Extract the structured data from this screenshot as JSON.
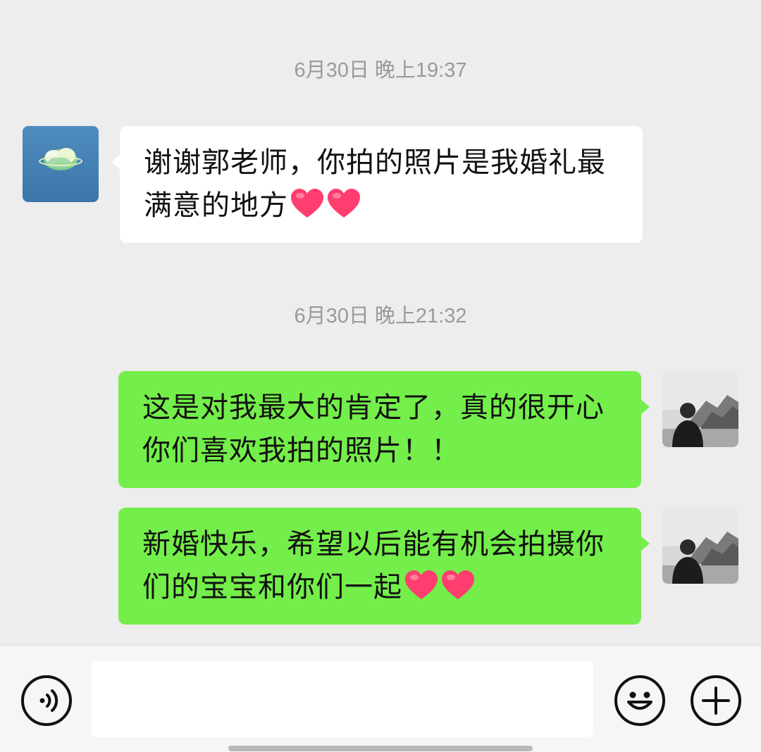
{
  "messages": [
    {
      "timestamp": "6月30日 晚上19:37",
      "side": "left",
      "text": "谢谢郭老师，你拍的照片是我婚礼最满意的地方",
      "hearts": 2
    },
    {
      "timestamp": "6月30日 晚上21:32",
      "side": "right",
      "text": "这是对我最大的肯定了，真的很开心你们喜欢我拍的照片！！",
      "hearts": 0
    },
    {
      "side": "right",
      "text": "新婚快乐，希望以后能有机会拍摄你们的宝宝和你们一起",
      "hearts": 2
    }
  ],
  "input_bar": {
    "voice_icon": "voice-icon",
    "emoji_icon": "emoji-icon",
    "more_icon": "plus-icon",
    "input_value": ""
  },
  "colors": {
    "background": "#ededed",
    "sent_bubble": "#74ee4a",
    "received_bubble": "#ffffff",
    "heart": "#ff3d6e"
  }
}
